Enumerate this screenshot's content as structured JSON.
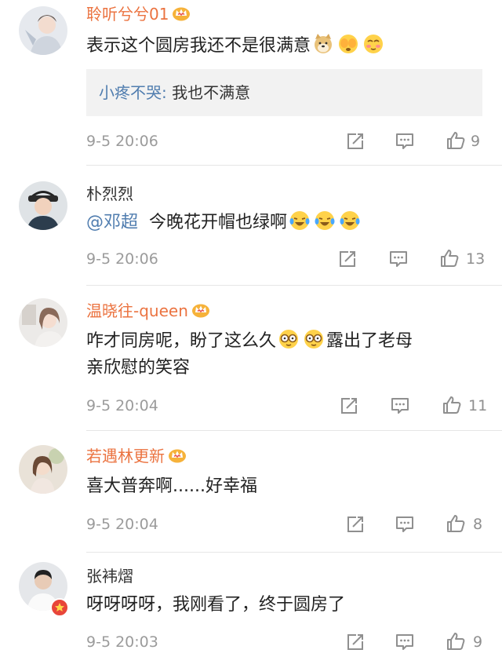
{
  "comments": [
    {
      "username": "聆听兮兮01",
      "text": "表示这个圆房我还不是很满意",
      "reply": {
        "name": "小疼不哭:",
        "text": " 我也不满意"
      },
      "time": "9-5 20:06",
      "likes": "9"
    },
    {
      "username": "朴烈烈",
      "mention": "@邓超",
      "text": "今晚花开帽也绿啊",
      "time": "9-5 20:06",
      "likes": "13"
    },
    {
      "username": "温晓往-queen",
      "text_line1_a": "咋才同房呢，盼了这么久",
      "text_line1_b": "露出了老母",
      "text_line2": "亲欣慰的笑容",
      "time": "9-5 20:04",
      "likes": "11"
    },
    {
      "username": "若遇林更新",
      "text": "喜大普奔啊......好幸福",
      "time": "9-5 20:04",
      "likes": "8"
    },
    {
      "username": "张袆熠",
      "text": "呀呀呀呀，我刚看了，终于圆房了",
      "time": "9-5 20:03",
      "likes": "9"
    }
  ],
  "icons": {
    "share": "share-icon",
    "comment": "comment-icon",
    "like": "thumbs-up-icon",
    "crown": "vip-crown-icon"
  },
  "colors": {
    "vip_name": "#eb7340",
    "mention": "#507daf",
    "muted": "#9b9b9b",
    "reply_bg": "#f2f2f2"
  }
}
